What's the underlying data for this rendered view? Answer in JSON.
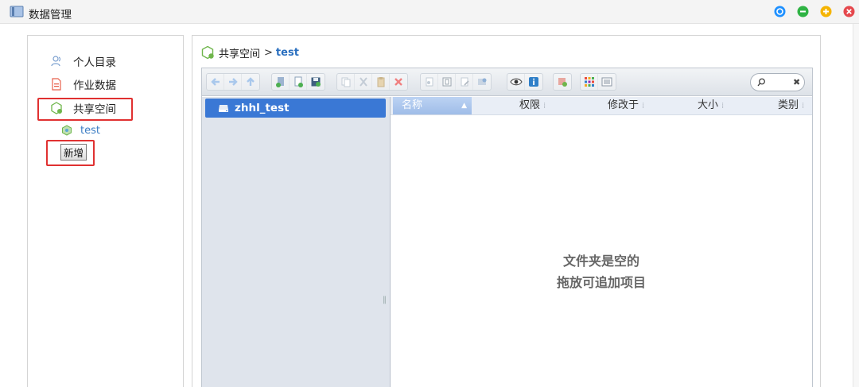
{
  "window": {
    "title": "数据管理",
    "icon": "folder-book-icon",
    "buttons": [
      {
        "name": "target-button",
        "color": "#1e90ff"
      },
      {
        "name": "minimize-button",
        "color": "#2fb344"
      },
      {
        "name": "maximize-button",
        "color": "#f5b400"
      },
      {
        "name": "close-button",
        "color": "#e5484d"
      }
    ]
  },
  "sidebar": {
    "items": [
      {
        "label": "个人目录",
        "icon": "user-icon"
      },
      {
        "label": "作业数据",
        "icon": "document-icon"
      },
      {
        "label": "共享空间",
        "icon": "share-space-icon",
        "highlighted": true
      }
    ],
    "sub_items": [
      {
        "label": "test",
        "icon": "share-folder-icon"
      }
    ],
    "add_button_label": "新增"
  },
  "breadcrumb": {
    "root": "共享空间",
    "separator": ">",
    "current": "test"
  },
  "file_browser": {
    "toolbar_icons": [
      "back-arrow-icon",
      "forward-arrow-icon",
      "up-arrow-icon",
      "new-folder-icon",
      "new-file-icon",
      "save-icon",
      "copy-icon",
      "cut-icon",
      "paste-icon",
      "delete-icon",
      "duplicate-icon",
      "select-icon",
      "edit-icon",
      "extract-icon",
      "preview-eye-icon",
      "info-icon",
      "upload-icon",
      "grid-view-icon",
      "list-view-icon"
    ],
    "search": {
      "placeholder": "",
      "clear_label": "✖"
    },
    "tree": [
      {
        "label": "zhhl_test",
        "icon": "drive-icon",
        "selected": true
      }
    ],
    "columns": [
      {
        "label": "名称",
        "sorted": "asc"
      },
      {
        "label": "权限"
      },
      {
        "label": "修改于"
      },
      {
        "label": "大小"
      },
      {
        "label": "类别"
      }
    ],
    "empty_line1": "文件夹是空的",
    "empty_line2": "拖放可追加项目"
  },
  "colors": {
    "accent": "#3a78d5",
    "annotation_red": "#e03131",
    "link_blue": "#2a6fbf"
  }
}
